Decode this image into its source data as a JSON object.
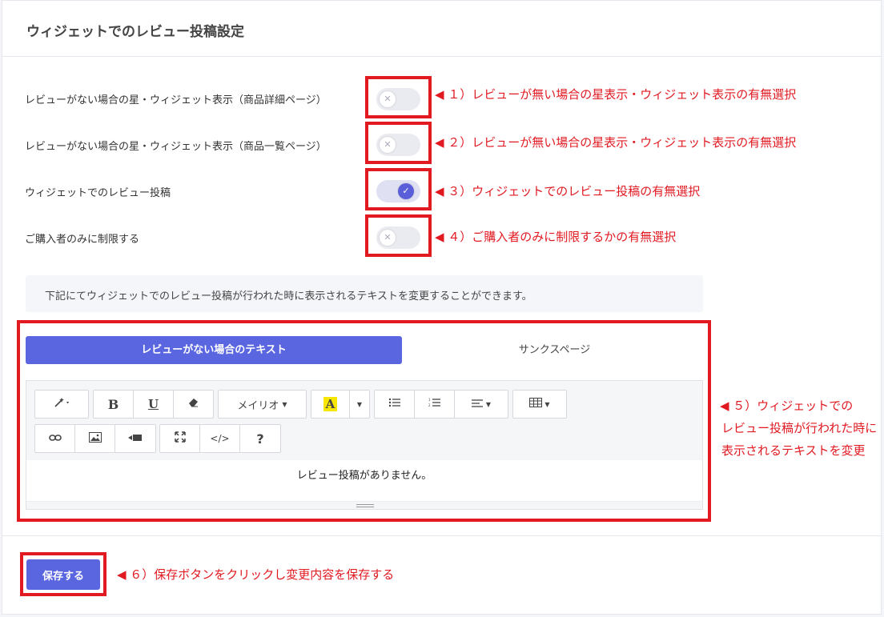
{
  "page": {
    "title": "ウィジェットでのレビュー投稿設定"
  },
  "settings": [
    {
      "label": "レビューがない場合の星・ウィジェット表示（商品詳細ページ）",
      "on": false,
      "annotation": "◀ １）レビューが無い場合の星表示・ウィジェット表示の有無選択"
    },
    {
      "label": "レビューがない場合の星・ウィジェット表示（商品一覧ページ）",
      "on": false,
      "annotation": "◀ ２）レビューが無い場合の星表示・ウィジェット表示の有無選択"
    },
    {
      "label": "ウィジェットでのレビュー投稿",
      "on": true,
      "annotation": "◀ ３）ウィジェットでのレビュー投稿の有無選択"
    },
    {
      "label": "ご購入者のみに制限する",
      "on": false,
      "annotation": "◀ ４）ご購入者のみに制限するかの有無選択"
    }
  ],
  "note": "下記にてウィジェットでのレビュー投稿が行われた時に表示されるテキストを変更することができます。",
  "tabs": {
    "active": "レビューがない場合のテキスト",
    "inactive": "サンクスページ"
  },
  "toolbar": {
    "font_name": "メイリオ",
    "bold": "B",
    "underline": "U",
    "code": "</>",
    "help": "?",
    "highlight_letter": "A"
  },
  "editor": {
    "content": "レビュー投稿がありません。"
  },
  "annotation5": {
    "line1": "◀ ５）ウィジェットでの",
    "line2": "レビュー投稿が行われた時に",
    "line3": "表示されるテキストを変更"
  },
  "save": {
    "label": "保存する",
    "annotation": "◀ ６）保存ボタンをクリックし変更内容を保存する"
  },
  "colors": {
    "accent": "#5a65e0",
    "annotation_red": "#e11a22",
    "highlight_yellow": "#f7e600"
  },
  "icons": [
    "magic-wand-icon",
    "eraser-icon",
    "unordered-list-icon",
    "ordered-list-icon",
    "align-icon",
    "table-icon",
    "link-icon",
    "image-icon",
    "video-icon",
    "fullscreen-icon",
    "code-view-icon",
    "help-icon",
    "check-icon",
    "close-icon"
  ]
}
